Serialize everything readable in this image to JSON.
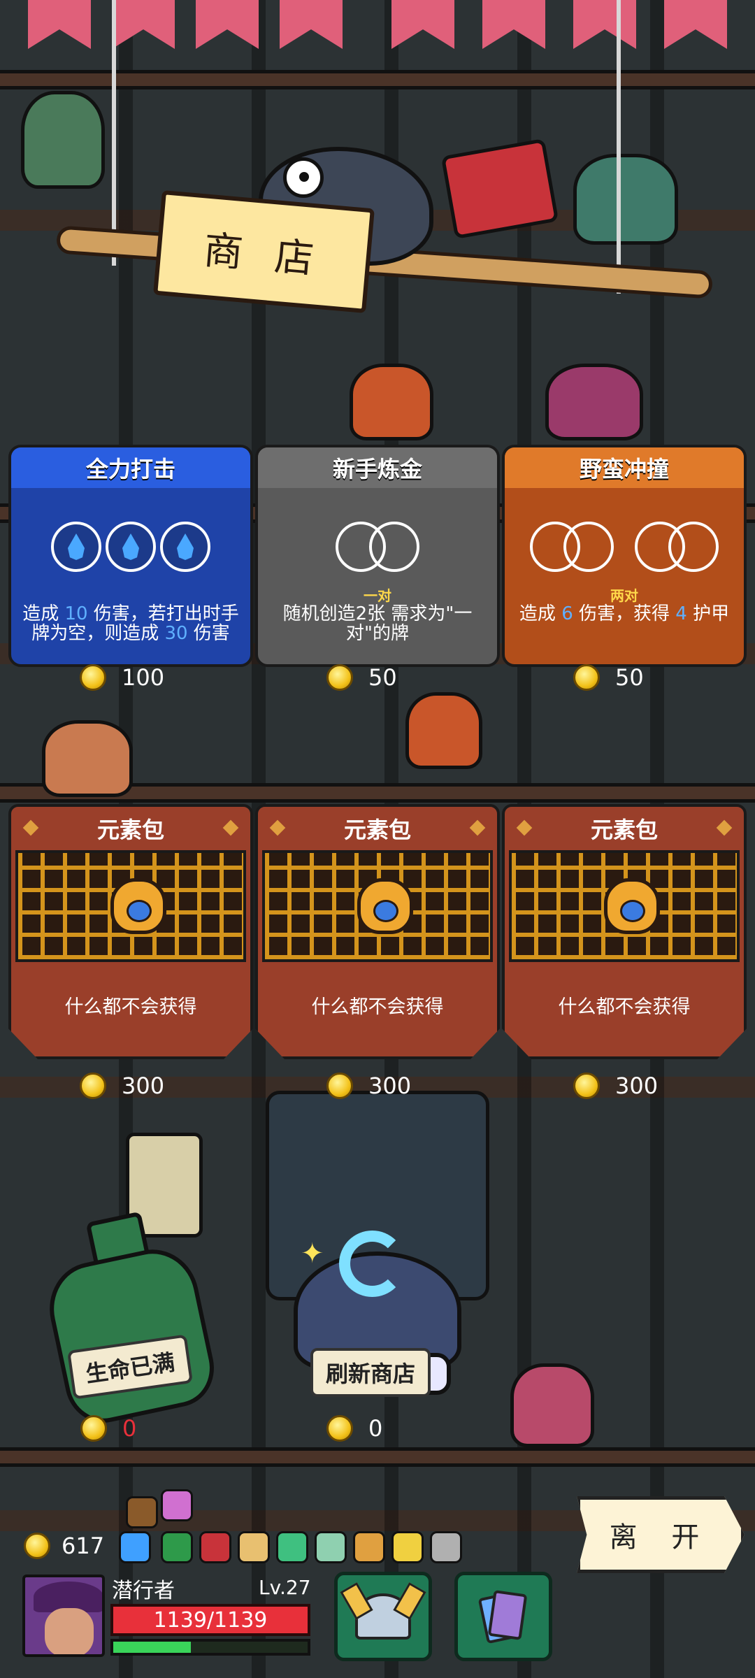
{
  "shop": {
    "sign": "商 店",
    "skill_cards": [
      {
        "title": "全力打击",
        "theme": "#1f43a8",
        "header": "#2a5ee0",
        "orb_type": "water",
        "orb_count": 3,
        "sub": "",
        "desc_parts": [
          "造成 ",
          "10",
          " 伤害，若打出时手牌为空，则造成 ",
          "30",
          " 伤害"
        ],
        "price": "100"
      },
      {
        "title": "新手炼金",
        "theme": "#5a5a5a",
        "header": "#6e6e6e",
        "orb_type": "pair",
        "sub": "一对",
        "desc_parts": [
          "随机创造2张 需求为\"一对\"的牌",
          "",
          "",
          "",
          ""
        ],
        "price": "50"
      },
      {
        "title": "野蛮冲撞",
        "theme": "#b24e1a",
        "header": "#e07a2a",
        "orb_type": "two-pair",
        "sub": "两对",
        "desc_parts": [
          "造成 ",
          "6",
          " 伤害，获得 ",
          "4",
          " 护甲"
        ],
        "price": "50"
      }
    ],
    "packs": [
      {
        "title": "元素包",
        "desc": "什么都不会获得",
        "price": "300"
      },
      {
        "title": "元素包",
        "desc": "什么都不会获得",
        "price": "300"
      },
      {
        "title": "元素包",
        "desc": "什么都不会获得",
        "price": "300"
      }
    ],
    "heal": {
      "label": "生命已满",
      "price": "0"
    },
    "refresh": {
      "label": "刷新商店",
      "price": "0"
    },
    "leave_label": "离 开"
  },
  "player": {
    "gold": "617",
    "name": "潜行者",
    "level": "Lv.27",
    "hp": "1139/1139",
    "hp_fraction": 1.0,
    "xp_fraction": 0.4,
    "relic_icons": [
      "pipe-icon",
      "pink-gem-icon",
      "blue-flame-icon",
      "green-dragon-icon",
      "red-heart-card-icon",
      "flower-pot-icon",
      "green-potion-icon",
      "jade-vase-icon",
      "horn-icon",
      "lemon-icon",
      "battery-icon"
    ]
  },
  "colors": {
    "gold": "#f3c21a",
    "hp": "#e8303a",
    "xp": "#3ad45a",
    "heal_price": "#e8303a"
  }
}
